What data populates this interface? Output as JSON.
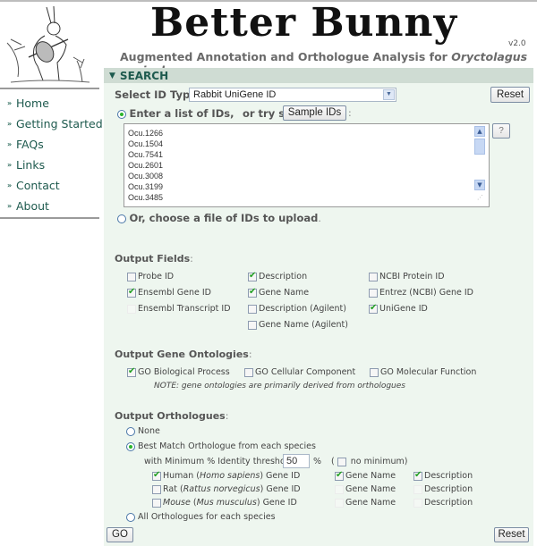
{
  "header": {
    "title": "Better Bunny",
    "version": "v2.0",
    "subtitle_prefix": "Augmented Annotation and Orthologue Analysis for ",
    "subtitle_species": "Oryctolagus cuniculus"
  },
  "sidebar": {
    "items": [
      {
        "label": "Home"
      },
      {
        "label": "Getting Started"
      },
      {
        "label": "FAQs"
      },
      {
        "label": "Links"
      },
      {
        "label": "Contact"
      },
      {
        "label": "About"
      }
    ]
  },
  "search": {
    "heading": "SEARCH",
    "id_type_label": "Select ID Type",
    "id_type_value": "Rabbit UniGene ID",
    "reset_label": "Reset",
    "enter_list_label": "Enter a list of IDs,",
    "try_some_label": "or try some",
    "sample_ids_label": "Sample IDs",
    "help_label": "?",
    "ids": [
      "Ocu.1266",
      "Ocu.1504",
      "Ocu.7541",
      "Ocu.2601",
      "Ocu.3008",
      "Ocu.3199",
      "Ocu.3485"
    ],
    "upload_label": "Or, choose a file of IDs to upload",
    "input_mode": "list"
  },
  "output_fields": {
    "heading": "Output Fields",
    "options": [
      {
        "label": "Probe ID",
        "checked": false,
        "disabled": false
      },
      {
        "label": "Description",
        "checked": true,
        "disabled": false
      },
      {
        "label": "NCBI Protein ID",
        "checked": false,
        "disabled": false
      },
      {
        "label": "Ensembl Gene ID",
        "checked": true,
        "disabled": false
      },
      {
        "label": "Gene Name",
        "checked": true,
        "disabled": false
      },
      {
        "label": "Entrez (NCBI) Gene ID",
        "checked": false,
        "disabled": false
      },
      {
        "label": "Ensembl Transcript ID",
        "checked": false,
        "disabled": true
      },
      {
        "label": "Description (Agilent)",
        "checked": false,
        "disabled": false
      },
      {
        "label": "UniGene ID",
        "checked": true,
        "disabled": false
      },
      {
        "label": "Gene Name (Agilent)",
        "checked": false,
        "disabled": false
      }
    ]
  },
  "gene_ontologies": {
    "heading": "Output Gene Ontologies",
    "options": [
      {
        "label": "GO Biological Process",
        "checked": true
      },
      {
        "label": "GO Cellular Component",
        "checked": false
      },
      {
        "label": "GO Molecular Function",
        "checked": false
      }
    ],
    "note": "NOTE: gene ontologies are primarily derived from orthologues"
  },
  "orthologues": {
    "heading": "Output Orthologues",
    "none_label": "None",
    "best_match_label": "Best Match Orthologue from each species",
    "threshold_label": "with Minimum % Identity threshold:",
    "threshold_value": "50",
    "percent_sign": "%",
    "no_minimum_label": "no minimum)",
    "no_minimum_open": "(",
    "no_minimum_checked": false,
    "selected": "best_match",
    "species": [
      {
        "name": "Human",
        "latin": "Homo sapiens",
        "suffix": "Gene ID",
        "gene_id": true,
        "gene_name": true,
        "description": true,
        "row_disabled": false
      },
      {
        "name": "Rat",
        "latin": "Rattus norvegicus",
        "suffix": "Gene ID",
        "gene_id": false,
        "gene_name": false,
        "description": false,
        "row_disabled": true
      },
      {
        "name": "Mouse",
        "latin": "Mus musculus",
        "suffix": "Gene ID",
        "gene_id": false,
        "gene_name": false,
        "description": false,
        "row_disabled": true
      }
    ],
    "gene_name_label": "Gene Name",
    "description_label": "Description",
    "all_label": "All Orthologues for each species"
  },
  "footer": {
    "go_label": "GO",
    "reset_label": "Reset"
  },
  "colors": {
    "panel_bg": "#eef6ef",
    "panel_header": "#cfdcd3",
    "nav_text": "#1e5a4e",
    "check": "#22a022"
  }
}
